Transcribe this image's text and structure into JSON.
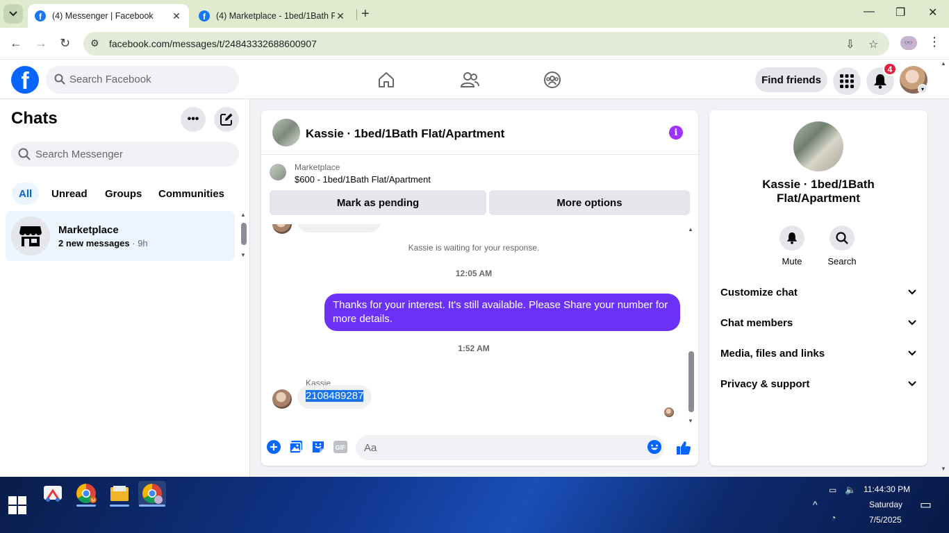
{
  "browser": {
    "tabs": [
      {
        "title": "(4) Messenger | Facebook",
        "active": true
      },
      {
        "title": "(4) Marketplace - 1bed/1Bath F",
        "active": false
      }
    ],
    "url": "facebook.com/messages/t/24843332688600907"
  },
  "fb": {
    "search_placeholder": "Search Facebook",
    "find_friends": "Find friends",
    "notification_count": "4"
  },
  "sidebar": {
    "title": "Chats",
    "search_placeholder": "Search Messenger",
    "filters": [
      "All",
      "Unread",
      "Groups",
      "Communities"
    ],
    "chats": [
      {
        "name": "Marketplace",
        "preview": "2 new messages",
        "sep": " · ",
        "time": "9h"
      }
    ]
  },
  "conversation": {
    "title": "Kassie · 1bed/1Bath Flat/Apartment",
    "marketplace_label": "Marketplace",
    "listing": "$600 - 1bed/1Bath Flat/Apartment",
    "mark_pending": "Mark as pending",
    "more_options": "More options",
    "system_message": "Kassie is waiting for your response.",
    "timestamp_1": "12:05 AM",
    "outgoing_message": "Thanks for your interest.  It's still available. Please Share your number for more details.",
    "timestamp_2": "1:52 AM",
    "incoming_sender": "Kassie",
    "incoming_message": "2108489287",
    "composer_placeholder": "Aa"
  },
  "right_panel": {
    "name_line1": "Kassie · 1bed/1Bath",
    "name_line2": "Flat/Apartment",
    "mute": "Mute",
    "search": "Search",
    "sections": [
      "Customize chat",
      "Chat members",
      "Media, files and links",
      "Privacy & support"
    ]
  },
  "taskbar": {
    "time": "11:44:30 PM",
    "day": "Saturday",
    "date": "7/5/2025"
  },
  "colors": {
    "fb_blue": "#0866ff",
    "outgoing_bubble": "#6b31f7",
    "info_purple": "#a033ff",
    "selected_chat_bg": "#ebf5ff"
  }
}
